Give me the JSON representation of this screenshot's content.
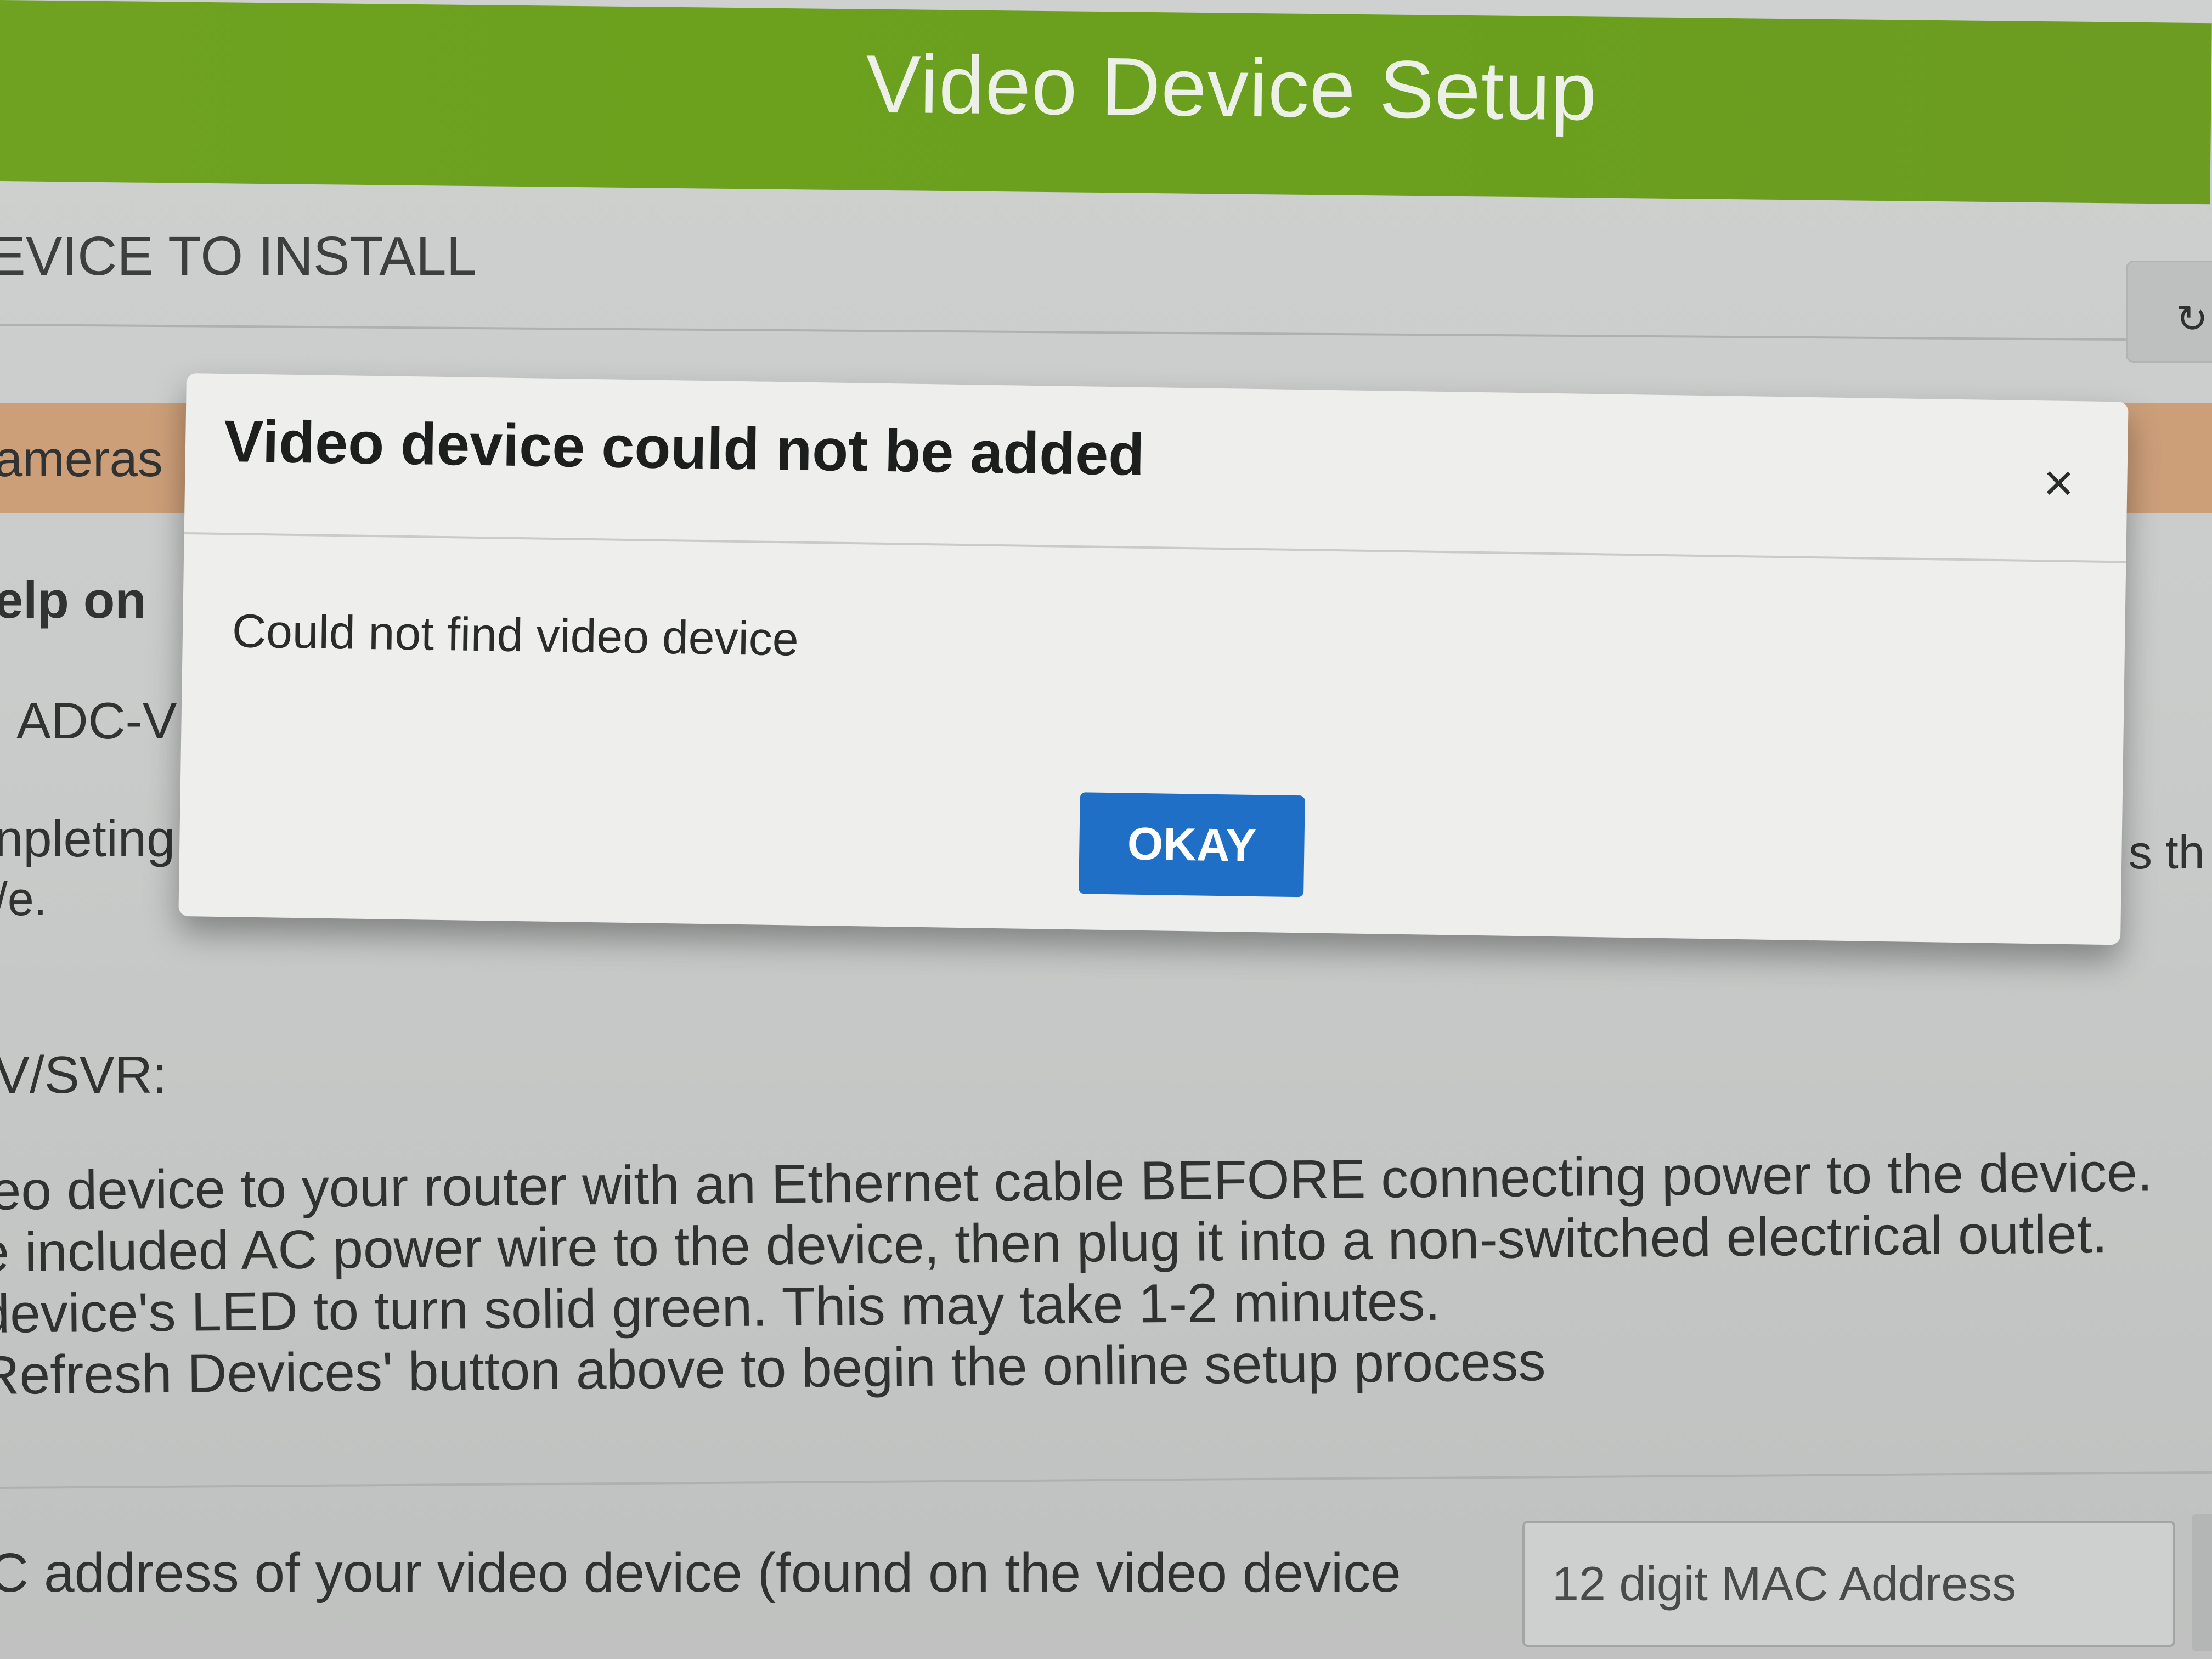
{
  "header": {
    "title": "Video Device Setup"
  },
  "toolbar": {
    "refresh_icon": "refresh-icon"
  },
  "background": {
    "section_label": "EVICE TO INSTALL",
    "cameras_fragment": "ameras",
    "help_fragment": "elp on",
    "adc_fragment": "ADC-V",
    "completing_fragment": "npleting",
    "ve_fragment": "/e.",
    "right_fragment": "s th",
    "svr_heading": "V/SVR:",
    "instructions": [
      "leo device to your router with an Ethernet cable BEFORE connecting power to the device.",
      "e included AC power wire to the device, then plug it into a non-switched electrical outlet.",
      " device's LED to turn solid green. This may take 1-2 minutes.",
      "Refresh Devices' button above to begin the online setup process"
    ],
    "mac_label": "C address of your video device (found on the video device",
    "mac_placeholder": "12 digit MAC Address"
  },
  "modal": {
    "title": "Video device could not be added",
    "close_glyph": "×",
    "message": "Could not find video device",
    "okay_label": "OKAY"
  },
  "colors": {
    "header_green": "#6ea51c",
    "orange_strip": "#d1a27a",
    "primary_button": "#1f6fc7"
  }
}
